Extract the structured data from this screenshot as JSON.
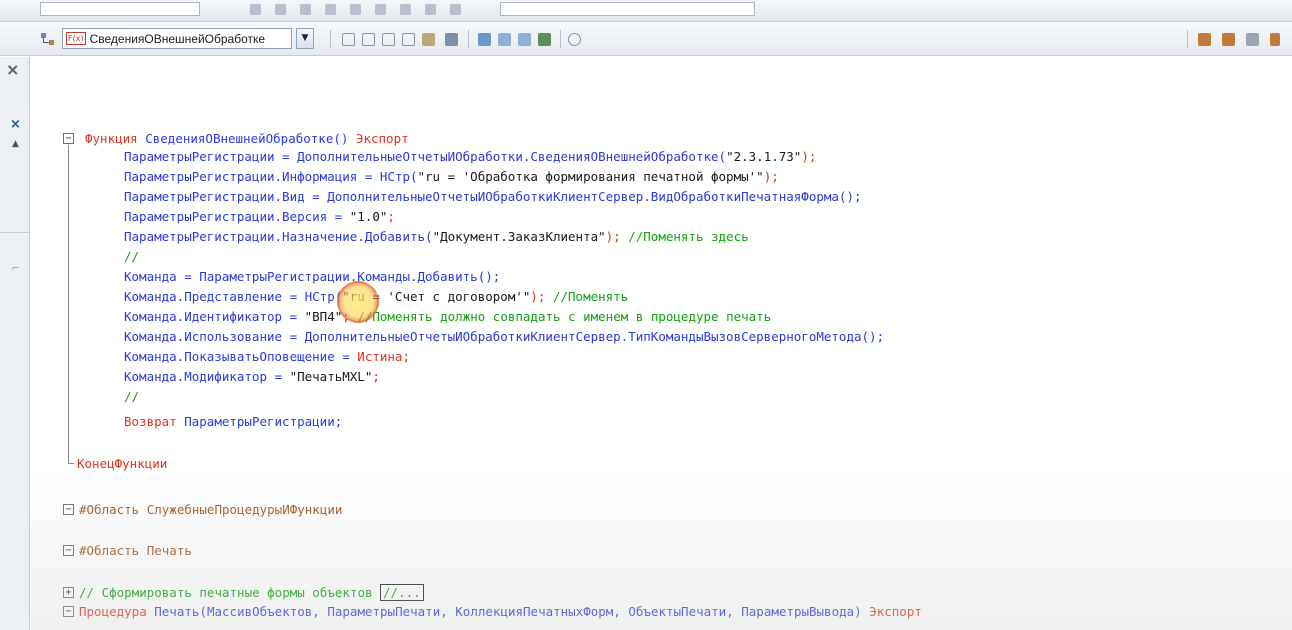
{
  "toolbar": {
    "procedure_select": "СведенияОВнешнейОбработке",
    "procedure_badge": "F(x)"
  },
  "side": {
    "close_label": "×",
    "up_label": "▲"
  },
  "code": {
    "func_decl_kw": "Функция",
    "func_decl_name": " СведенияОВнешнейОбработке() ",
    "func_decl_export": "Экспорт",
    "l1_a": "ПараметрыРегистрации = ДополнительныеОтчетыИОбработки.СведенияОВнешнейОбработке(",
    "l1_b": "\"2.3.1.73\"",
    "l1_c": ");",
    "l2_a": "ПараметрыРегистрации.Информация = НСтр(",
    "l2_b": "\"ru = 'Обработка формирования печатной формы'\"",
    "l2_c": ");",
    "l3_a": "ПараметрыРегистрации.Вид = ДополнительныеОтчетыИОбработкиКлиентСервер.ВидОбработкиПечатнаяФорма();",
    "l4_a": "ПараметрыРегистрации.Версия = ",
    "l4_b": "\"1.0\"",
    "l4_c": ";",
    "l5_a": "ПараметрыРегистрации.Назначение.Добавить(",
    "l5_b": "\"Документ.ЗаказКлиента\"",
    "l5_c": "); ",
    "l5_d": "//Поменять здесь",
    "l6": "//",
    "l7_a": "Команда = ПараметрыРегистрации.Команды.Добавить();",
    "l8_a": "Команда.Представление = НСтр(",
    "l8_b": "\"ru = 'Счет с договором'\"",
    "l8_c": "); ",
    "l8_d": "//Поменять",
    "l9_a": "Команда.Идентификатор = ",
    "l9_b": "\"ВП4\"",
    "l9_c": "; ",
    "l9_d": "//Поменять должно совпадать с именем в процедуре печать",
    "l10_a": "Команда.Использование = ДополнительныеОтчетыИОбработкиКлиентСервер.ТипКомандыВызовСерверногоМетода();",
    "l11_a": "Команда.ПоказыватьОповещение = ",
    "l11_b": "Истина",
    "l11_c": ";",
    "l12_a": "Команда.Модификатор = ",
    "l12_b": "\"ПечатьMXL\"",
    "l12_c": ";",
    "l13": "//",
    "l14_a": "Возврат",
    "l14_b": " ПараметрыРегистрации;",
    "end_func": "КонецФункции",
    "region1": "#Область СлужебныеПроцедурыИФункции",
    "region2": "#Область Печать",
    "comment_print": "// Сформировать печатные формы объектов ",
    "comment_box": "//...",
    "proc_kw": "Процедура",
    "proc_name": " Печать(МассивОбъектов, ПараметрыПечати, КоллекцияПечатныхФорм, ОбъектыПечати, ПараметрыВывода) ",
    "proc_export": "Экспорт"
  }
}
